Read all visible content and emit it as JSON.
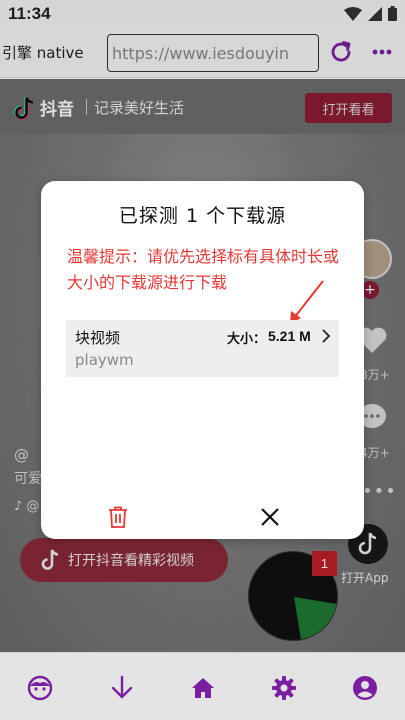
{
  "status_bar": {
    "time": "11:34"
  },
  "toolbar": {
    "app_title": "引擎 native",
    "url_value": "https://www.iesdouyin"
  },
  "douyin_page": {
    "brand": "抖音",
    "slogan": "记录美好生活",
    "open_button": "打开看看",
    "like_count": "8万+",
    "comment_count": "4万+",
    "side_app_label": "打开App",
    "user_fragment": "@",
    "desc_fragment": "可爱",
    "music_fragment": "♪ @",
    "open_video_button": "打开抖音看精彩视频",
    "badge_count": "1"
  },
  "dialog": {
    "title": "已探测 1 个下载源",
    "tip": "温馨提示：请优先选择标有具体时长或大小的下载源进行下载",
    "source": {
      "type": "块视频",
      "size_label": "大小：",
      "size_value": "5.21 M",
      "name": "playwm"
    }
  },
  "colors": {
    "accent": "#7b1fa2",
    "tip_red": "#e53935",
    "douyin_red": "#8b1c33"
  },
  "icons": {
    "nav": [
      "face-icon",
      "download-icon",
      "home-icon",
      "settings-icon",
      "account-icon"
    ]
  }
}
